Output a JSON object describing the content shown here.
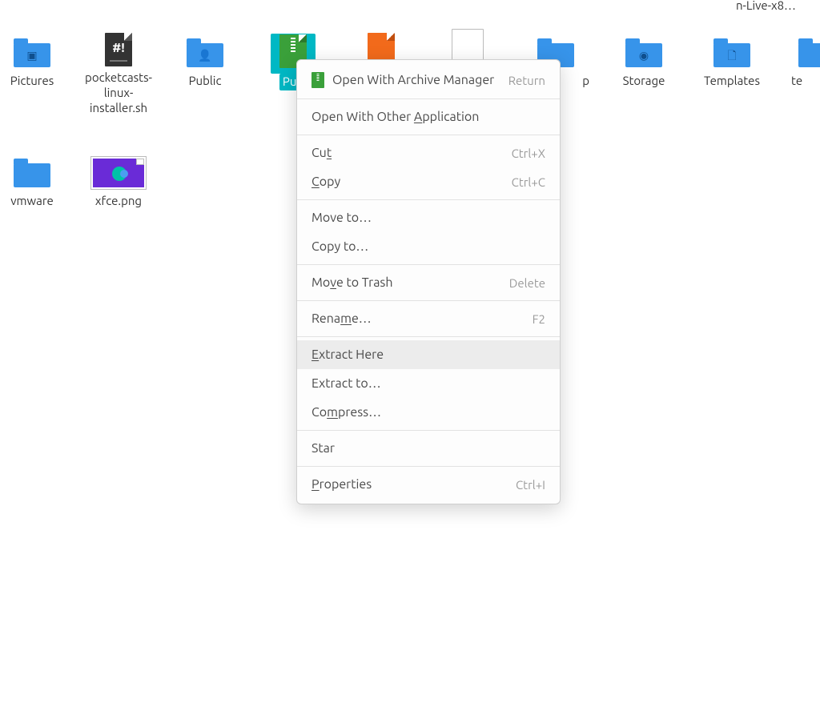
{
  "truncated_top_label": "n-Live-x8…",
  "icons": {
    "pictures": {
      "label": "Pictures"
    },
    "pocketcasts": {
      "label": "pocketcasts-linux-installer.sh"
    },
    "public": {
      "label": "Public"
    },
    "pubarchive": {
      "label": "Pub"
    },
    "orangedoc": {
      "label": ""
    },
    "whitedoc": {
      "label": ""
    },
    "bluefolder_partial": {
      "label": "p"
    },
    "storage": {
      "label": "Storage"
    },
    "templates": {
      "label": "Templates"
    },
    "tfolder": {
      "label": "te"
    },
    "vmware": {
      "label": "vmware"
    },
    "xfce": {
      "label": "xfce.png"
    }
  },
  "menu": {
    "open_archive": {
      "label": "Open With Archive Manager",
      "accel": "Return"
    },
    "open_other": {
      "label_pre": "Open With Other ",
      "label_u": "A",
      "label_post": "pplication"
    },
    "cut": {
      "label_pre": "Cu",
      "label_u": "t",
      "accel": "Ctrl+X"
    },
    "copy": {
      "label_u": "C",
      "label_post": "opy",
      "accel": "Ctrl+C"
    },
    "move_to": {
      "label": "Move to…"
    },
    "copy_to": {
      "label": "Copy to…"
    },
    "trash": {
      "label_pre": "Mo",
      "label_u": "v",
      "label_post": "e to Trash",
      "accel": "Delete"
    },
    "rename": {
      "label_pre": "Rena",
      "label_u": "m",
      "label_post": "e…",
      "accel": "F2"
    },
    "extract_here": {
      "label_u": "E",
      "label_post": "xtract Here"
    },
    "extract_to": {
      "label": "Extract to…"
    },
    "compress": {
      "label_pre": "Co",
      "label_u": "m",
      "label_post": "press…"
    },
    "star": {
      "label": "Star"
    },
    "properties": {
      "label_u": "P",
      "label_post": "roperties",
      "accel": "Ctrl+I"
    }
  }
}
